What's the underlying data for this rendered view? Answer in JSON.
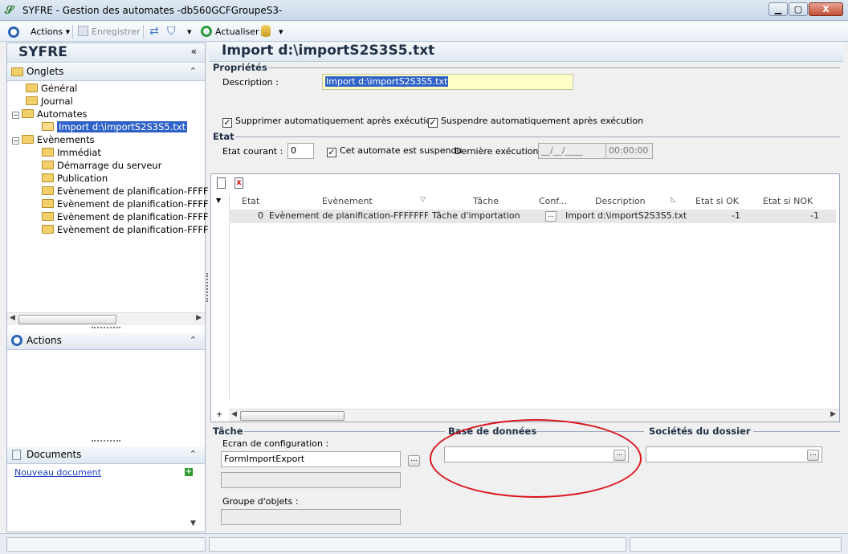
{
  "window": {
    "icon": "syfre-app-icon",
    "title": "SYFRE -  Gestion des automates -db560GCFGroupeS3-",
    "close_symbol": "X"
  },
  "toolbar": {
    "actions_label": "Actions",
    "save_label": "Enregistrer",
    "refresh_label": "Actualiser"
  },
  "sidebar": {
    "app_name": "SYFRE",
    "tabs_title": "Onglets",
    "tree": {
      "general": "Général",
      "journal": "Journal",
      "automates": "Automates",
      "automate_selected": "Import d:\\importS2S3S5.txt",
      "events": "Evènements",
      "event_items": [
        "Immédiat",
        "Démarrage du serveur",
        "Publication",
        "Evènement de planification-FFFFI",
        "Evènement de planification-FFFFI",
        "Evènement de planification-FFFFI",
        "Evènement de planification-FFFFI"
      ]
    },
    "actions_title": "Actions",
    "documents_title": "Documents",
    "new_document_link": "Nouveau document"
  },
  "main": {
    "title": "Import d:\\importS2S3S5.txt",
    "properties": {
      "section": "Propriétés",
      "description_label": "Description :",
      "description_value": "Import d:\\importS2S3S5.txt",
      "delete_after_label": "Supprimer automatiquement après exécution",
      "suspend_after_label": "Suspendre automatiquement après exécution"
    },
    "state": {
      "section": "Etat",
      "current_label": "Etat courant :",
      "current_value": "0",
      "suspended_label": "Cet automate est suspendu",
      "last_exec_label": "Dernière exécution :",
      "last_exec_date": "__/__/____",
      "last_exec_time": "00:00:00"
    },
    "grid": {
      "columns": [
        "Etat",
        "Evènement",
        "Tâche",
        "Conf...",
        "Description",
        "Etat si OK",
        "Etat si NOK"
      ],
      "rows": [
        {
          "etat": "0",
          "evenement": "Evènement de planification-FFFFFFFFFFF",
          "tache": "Tâche d'importation",
          "conf": "...",
          "description": "Import d:\\importS2S3S5.txt",
          "ok": "-1",
          "nok": "-1"
        }
      ]
    },
    "task": {
      "section": "Tâche",
      "config_screen_label": "Ecran de configuration :",
      "config_screen_value": "FormImportExport",
      "object_group_label": "Groupe d'objets :",
      "browse_symbol": "..."
    },
    "database_section": "Base de données",
    "companies_section": "Sociétés du dossier"
  },
  "colors": {
    "selection": "#2f62c8",
    "annotation": "#d9141c",
    "highlight_input": "#ffffc8"
  }
}
